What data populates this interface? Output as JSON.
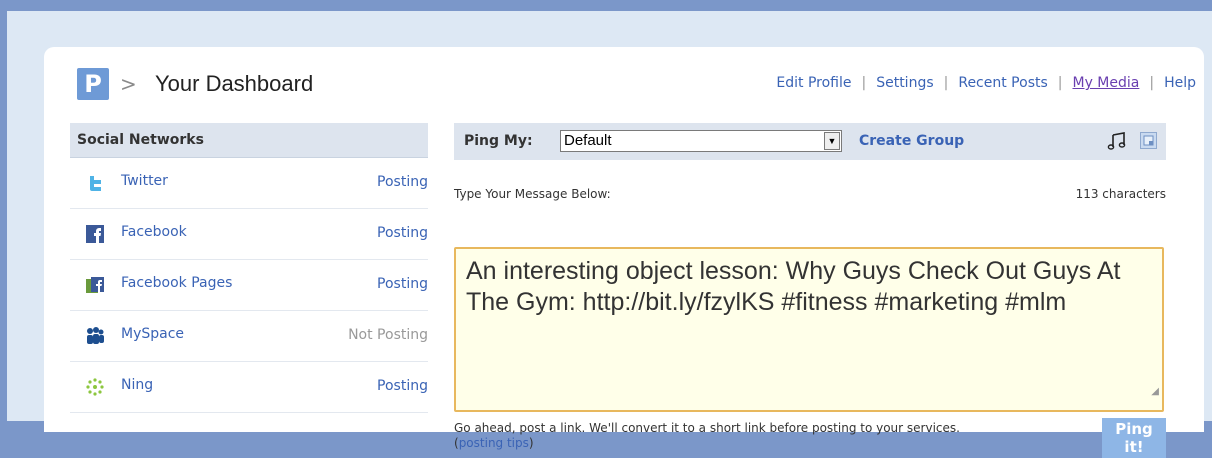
{
  "header": {
    "logo_letter": "P",
    "separator": ">",
    "title": "Your Dashboard",
    "nav": [
      "Edit Profile",
      "Settings",
      "Recent Posts",
      "My Media",
      "Help"
    ]
  },
  "sidebar": {
    "heading": "Social Networks",
    "networks": [
      {
        "name": "Twitter",
        "status": "Posting",
        "icon": "twitter-icon"
      },
      {
        "name": "Facebook",
        "status": "Posting",
        "icon": "facebook-icon"
      },
      {
        "name": "Facebook Pages",
        "status": "Posting",
        "icon": "facebook-pages-icon"
      },
      {
        "name": "MySpace",
        "status": "Not Posting",
        "icon": "myspace-icon"
      },
      {
        "name": "Ning",
        "status": "Posting",
        "icon": "ning-icon"
      }
    ]
  },
  "composer": {
    "ping_label": "Ping My:",
    "group_value": "Default",
    "create_group": "Create Group",
    "message_label": "Type Your Message Below:",
    "char_count": "113 characters",
    "message": "An interesting object lesson:  Why Guys Check Out Guys At The Gym:  http://bit.ly/fzylKS #fitness #marketing #mlm",
    "hint_text": "Go ahead, post a link. We'll convert it to a short link before posting to your services. (",
    "hint_link": "posting tips",
    "hint_close": ")",
    "ping_button": "Ping it!"
  },
  "colors": {
    "accent": "#3a63b5",
    "page_bg": "#7b97c9",
    "message_bg": "#ffffe9",
    "message_border": "#e8b85d",
    "button": "#8eb6e6"
  }
}
